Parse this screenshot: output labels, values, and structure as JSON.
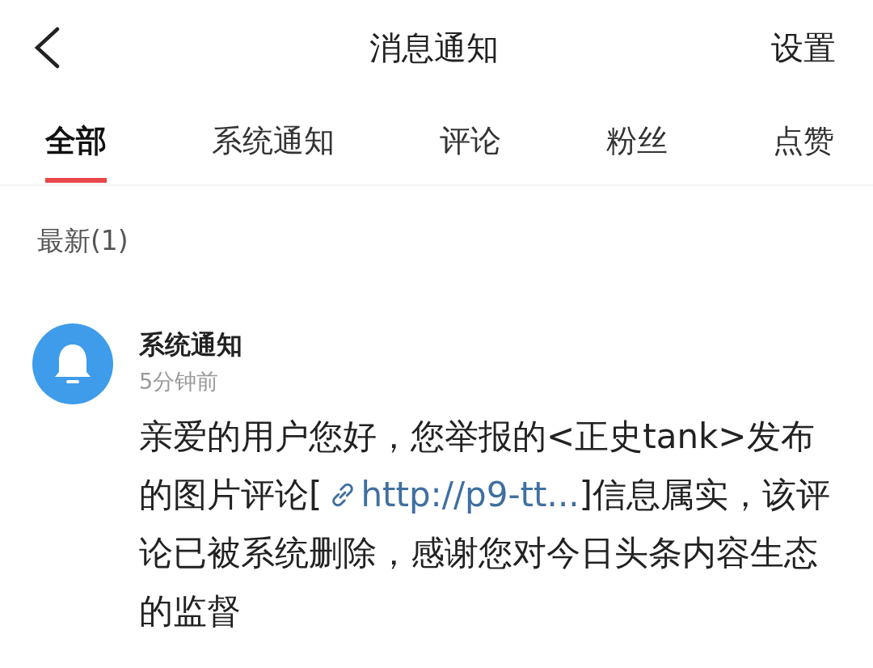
{
  "header": {
    "title": "消息通知",
    "action": "设置"
  },
  "tabs": [
    {
      "label": "全部",
      "selected": true
    },
    {
      "label": "系统通知",
      "selected": false
    },
    {
      "label": "评论",
      "selected": false
    },
    {
      "label": "粉丝",
      "selected": false
    },
    {
      "label": "点赞",
      "selected": false
    }
  ],
  "section_title": "最新(1)",
  "notifications": [
    {
      "sender": "系统通知",
      "time": "5分钟前",
      "text_before": "亲爱的用户您好，您举报的<正史tank>发布的图片评论[",
      "link": "http://p9-tt...",
      "text_after": "]信息属实，该评论已被系统删除，感谢您对今日头条内容生态的监督"
    }
  ]
}
